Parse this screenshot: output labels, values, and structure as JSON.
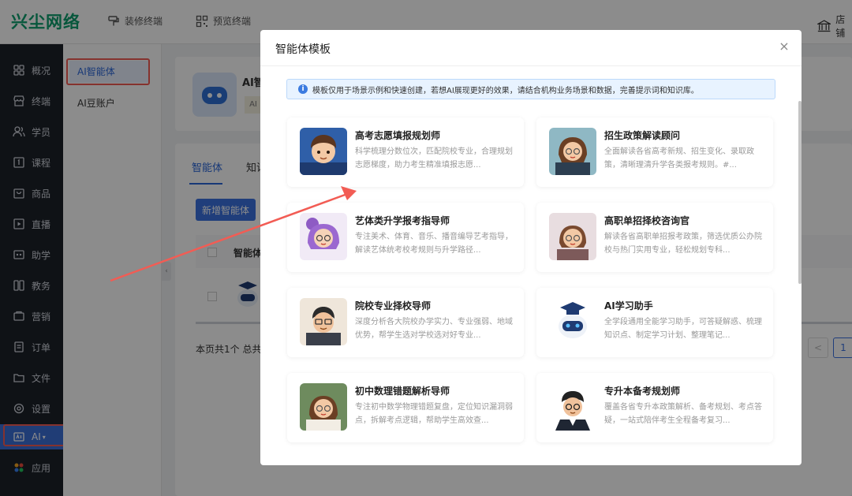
{
  "header": {
    "logo": "兴尘网络",
    "links": [
      {
        "label": "装修终端",
        "icon": "paint-roller-icon"
      },
      {
        "label": "预览终端",
        "icon": "qrcode-icon"
      }
    ],
    "store_label": "店铺"
  },
  "leftnav": {
    "items": [
      {
        "label": "概况",
        "icon": "grid-icon"
      },
      {
        "label": "终端",
        "icon": "store-icon"
      },
      {
        "label": "学员",
        "icon": "users-icon"
      },
      {
        "label": "课程",
        "icon": "book-icon"
      },
      {
        "label": "商品",
        "icon": "bag-icon"
      },
      {
        "label": "直播",
        "icon": "video-icon"
      },
      {
        "label": "助学",
        "icon": "helper-icon"
      },
      {
        "label": "教务",
        "icon": "columns-icon"
      },
      {
        "label": "营销",
        "icon": "coupon-icon"
      },
      {
        "label": "订单",
        "icon": "order-icon"
      },
      {
        "label": "文件",
        "icon": "folder-icon"
      },
      {
        "label": "设置",
        "icon": "gear-icon"
      },
      {
        "label": "AI",
        "icon": "ai-icon",
        "active": true
      },
      {
        "label": "应用",
        "icon": "apps-icon"
      }
    ]
  },
  "subnav": {
    "items": [
      {
        "label": "AI智能体",
        "selected": true
      },
      {
        "label": "AI豆账户",
        "selected": false
      }
    ]
  },
  "main": {
    "tabs": [
      "智能体",
      "知识"
    ],
    "heading_fragment": "AI智",
    "badge_fragment": "AI",
    "new_button": "新增智能体",
    "table_header_fragment": "智能体",
    "pager_fragment": "本页共1个  总共",
    "page_number": "1",
    "prev_arrow": "<"
  },
  "modal": {
    "title": "智能体模板",
    "close": "×",
    "notice": "模板仅用于场景示例和快速创建，若想AI展现更好的效果，请结合机构业务场景和数据，完善提示词和知识库。",
    "templates": [
      {
        "name": "高考志愿填报规划师",
        "desc": "科学梳理分数位次，匹配院校专业，合理规划志愿梯度，助力考生精准填报志愿...",
        "avatar": "boy-student-avatar"
      },
      {
        "name": "招生政策解读顾问",
        "desc": "全面解读各省高考新规、招生变化、录取政策，清晰理清升学各类报考规则。#...",
        "avatar": "woman-glasses-avatar"
      },
      {
        "name": "艺体类升学报考指导师",
        "desc": "专注美术、体育、音乐、播音编导艺考指导，解读艺体统考校考规则与升学路径...",
        "avatar": "purple-hair-avatar"
      },
      {
        "name": "高职单招择校咨询官",
        "desc": "解读各省高职单招报考政策，筛选优质公办院校与热门实用专业，轻松规划专科...",
        "avatar": "woman-bob-avatar"
      },
      {
        "name": "院校专业择校导师",
        "desc": "深度分析各大院校办学实力、专业强弱、地域优势，帮学生选对学校选对好专业...",
        "avatar": "man-glasses-avatar"
      },
      {
        "name": "AI学习助手",
        "desc": "全学段通用全能学习助手，可答疑解惑、梳理知识点、制定学习计划、整理笔记...",
        "avatar": "robot-graduate-avatar"
      },
      {
        "name": "初中数理错题解析导师",
        "desc": "专注初中数学物理错题复盘，定位知识漏洞弱点，拆解考点逻辑，帮助学生高效查...",
        "avatar": "woman-teacher-avatar"
      },
      {
        "name": "专升本备考规划师",
        "desc": "覆盖各省专升本政策解析、备考规划、考点答疑，一站式陪伴考生全程备考复习...",
        "avatar": "man-suit-avatar"
      }
    ]
  },
  "colors": {
    "brand": "#0e9f6e",
    "primary": "#3b72e0",
    "annotation": "#f25c54"
  }
}
